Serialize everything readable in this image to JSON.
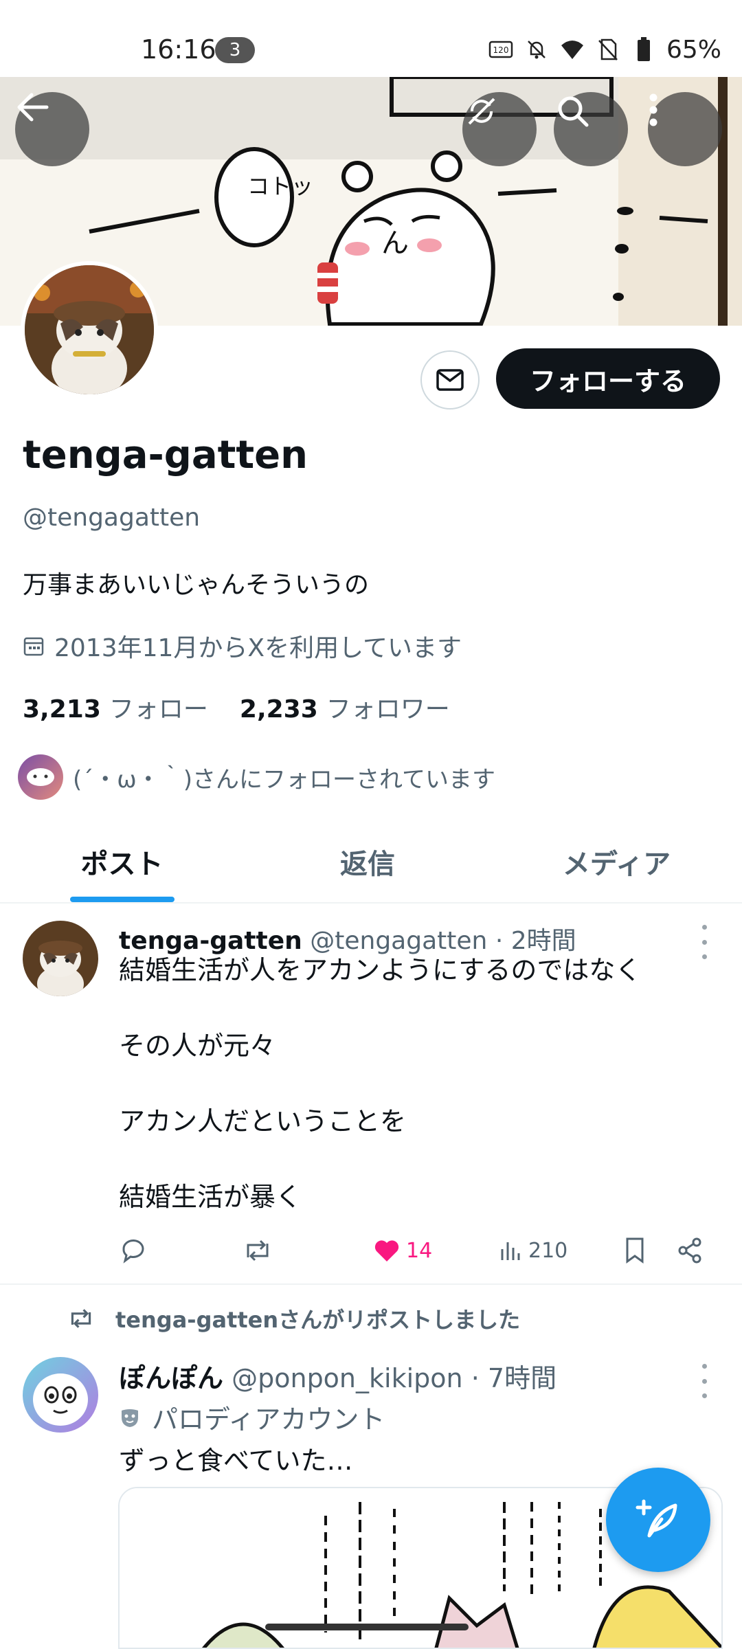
{
  "status_bar": {
    "time": "16:16",
    "notification_count": "3",
    "battery": "65%",
    "icons": [
      "refresh-rate-icon",
      "bell-off-icon",
      "wifi-icon",
      "no-sim-icon",
      "battery-icon"
    ]
  },
  "header": {
    "back_icon": "arrow-left-icon",
    "translate_icon": "no-translate-icon",
    "search_icon": "search-icon",
    "more_icon": "more-vertical-icon"
  },
  "profile": {
    "display_name": "tenga-gatten",
    "handle": "@tengagatten",
    "bio": "万事まあいいじゃんそういうの",
    "joined": "2013年11月からXを利用しています",
    "following_count": "3,213",
    "following_label": "フォロー",
    "followers_count": "2,233",
    "followers_label": "フォロワー",
    "followed_by": "(´・ω・｀)さんにフォローされています",
    "follow_button": "フォローする"
  },
  "tabs": [
    {
      "label": "ポスト",
      "active": true
    },
    {
      "label": "返信",
      "active": false
    },
    {
      "label": "メディア",
      "active": false
    }
  ],
  "posts": [
    {
      "author": "tenga-gatten",
      "handle": "@tengagatten",
      "time": "2時間",
      "lines": [
        "結婚生活が人をアカンようにするのではなく",
        "その人が元々",
        "アカン人だということを",
        "結婚生活が暴く"
      ],
      "likes": "14",
      "views": "210"
    },
    {
      "repost_note": "tenga-gattenさんがリポストしました",
      "author": "ぽんぽん",
      "handle": "@ponpon_kikipon",
      "time": "7時間",
      "badge": "パロディアカウント",
      "text": "ずっと食べていた…"
    }
  ],
  "colors": {
    "accent": "#1d9bf0",
    "like": "#f91880",
    "text_primary": "#0f1419",
    "text_secondary": "#536471"
  }
}
